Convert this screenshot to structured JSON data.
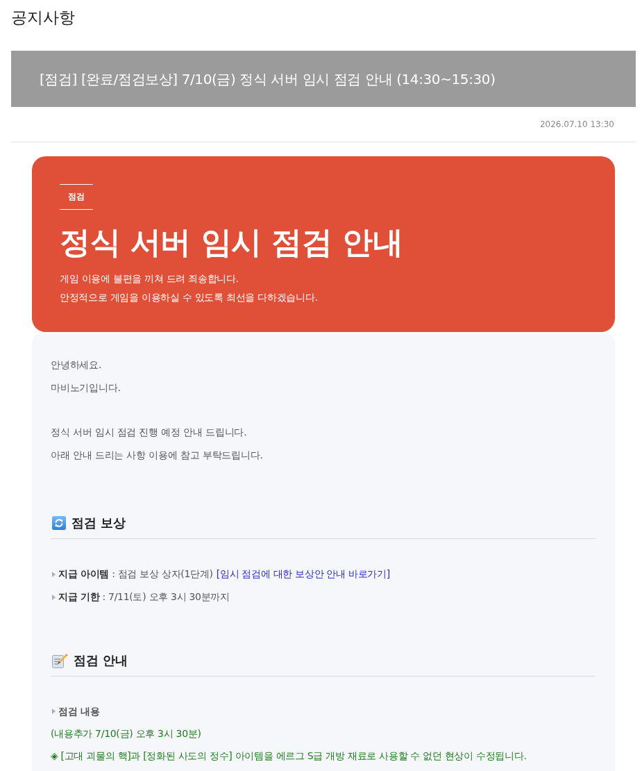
{
  "page_title": "공지사항",
  "notice": {
    "title": "[점검] [완료/점검보상] 7/10(금) 정식 서버 임시 점검 안내 (14:30~15:30)",
    "date": "2026.07.10 13:30"
  },
  "hero": {
    "tag": "점검",
    "title": "정식 서버 임시 점검 안내",
    "lines": [
      "게임 이용에 불편을 끼쳐 드려 죄송합니다.",
      "안정적으로 게임을 이용하실 수 있도록 최선을 다하겠습니다."
    ]
  },
  "intro": [
    [
      "안녕하세요.",
      "마비노기입니다."
    ],
    [
      "정식 서버 임시 점검 진행 예정 안내 드립니다.",
      "아래 안내 드리는 사항 이용에 참고 부탁드립니다."
    ]
  ],
  "sections": [
    {
      "kind": "reward",
      "title": "점검 보상",
      "items": [
        {
          "kind": "field",
          "text": "**지급 아이템** : 점검 보상 상자(1단계)",
          "link": "[임시 점검에 대한 보상안 안내 바로가기]"
        },
        {
          "kind": "field",
          "text": "**지급 기한** : 7/11(토) 오후 3시 30분까지"
        }
      ]
    },
    {
      "kind": "notice",
      "title": "점검 안내",
      "items": [
        {
          "kind": "subheading",
          "text": "점검 내용"
        },
        {
          "kind": "note",
          "text": "(내용추가 7/10(금) 오후 3시 30분)"
        },
        {
          "kind": "note",
          "text": "◈ [고대 괴물의 핵]과 [정화된 사도의 정수] 아이템을 에르그 S급 개방 재료로 사용할 수 없던 현상이 수정됩니다."
        }
      ]
    }
  ]
}
